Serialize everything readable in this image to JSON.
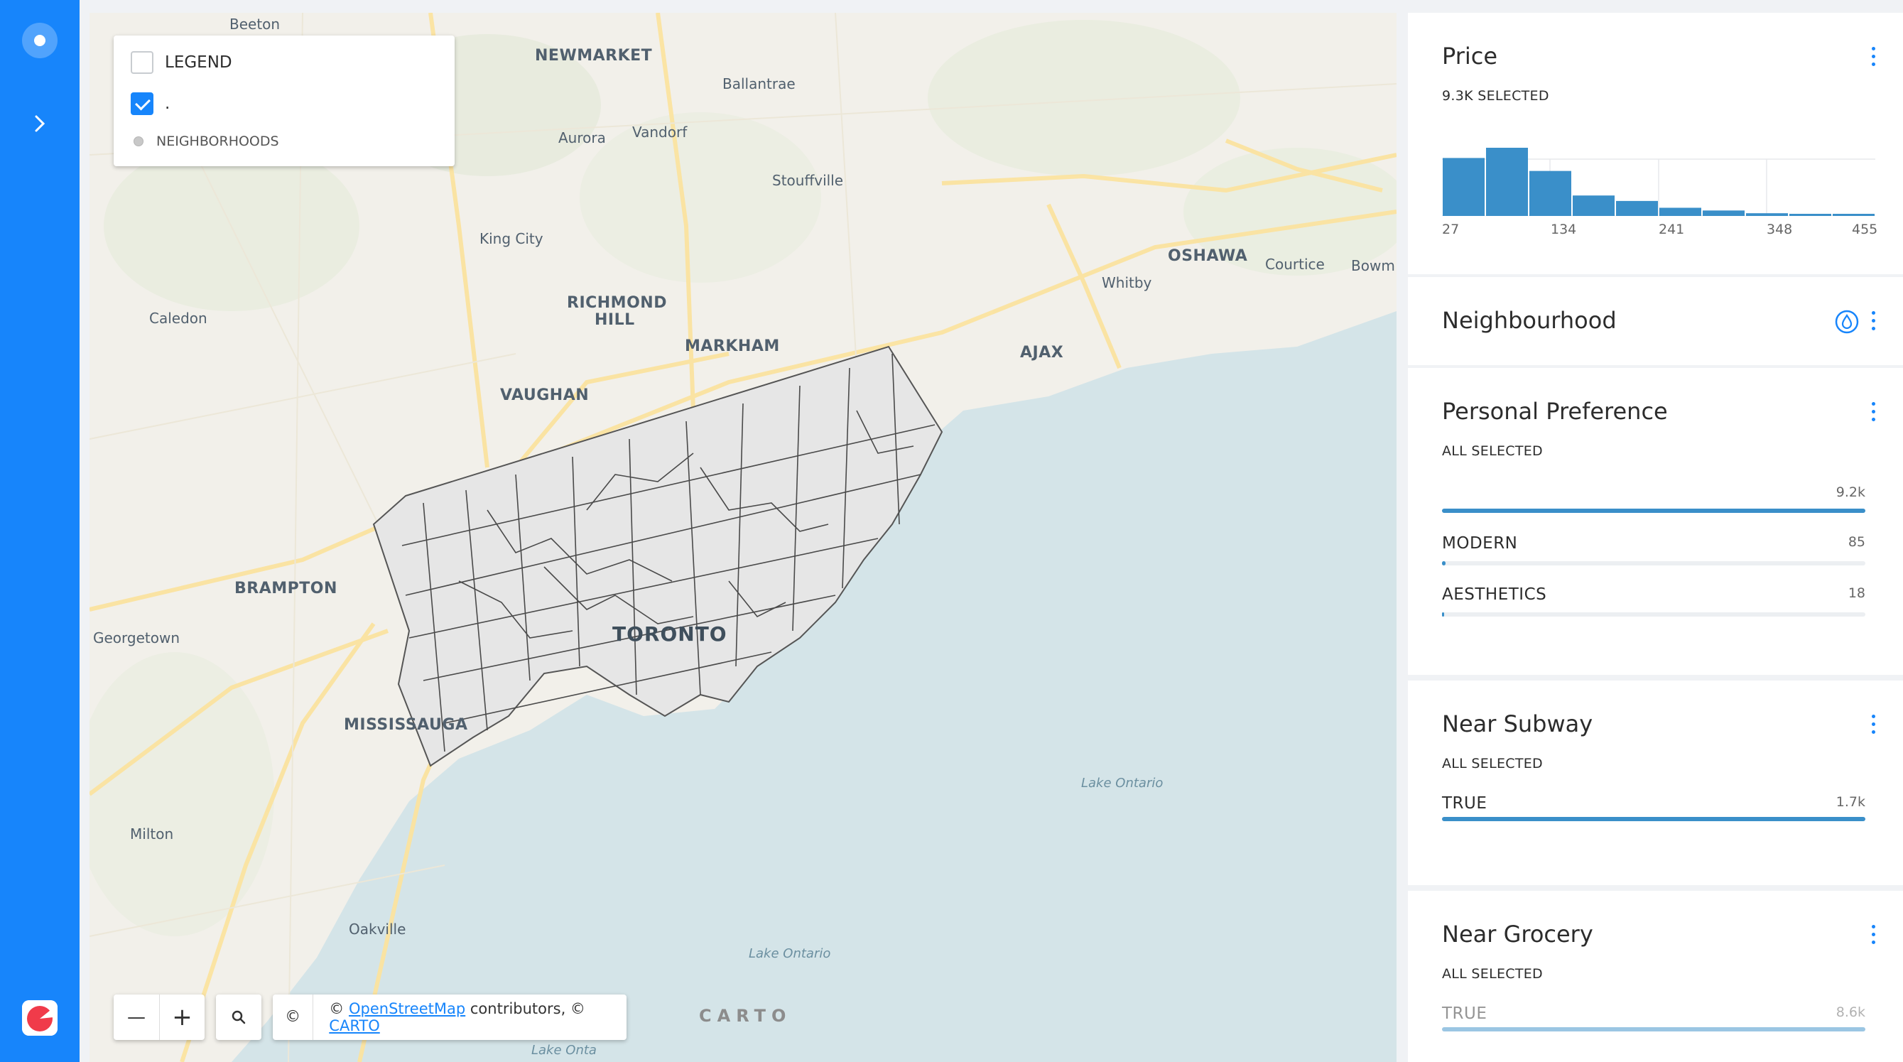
{
  "sidebar": {
    "top_icon": "circle-dot-icon",
    "expand_icon": "chevron-right-icon",
    "logo_icon": "carto-logo-icon",
    "accent": "#1785fb"
  },
  "map": {
    "legend": {
      "title": "LEGEND",
      "layer_label": ".",
      "item_label": "NEIGHBORHOODS"
    },
    "places": {
      "beeton": "Beeton",
      "newmarket": "NEWMARKET",
      "ballantrae": "Ballantrae",
      "aurora": "Aurora",
      "vandorf": "Vandorf",
      "stouffville": "Stouffville",
      "king_city": "King City",
      "oshawa": "OSHAWA",
      "courtice": "Courtice",
      "bowm": "Bowm",
      "whitby": "Whitby",
      "caledon": "Caledon",
      "richmond_hill_1": "RICHMOND",
      "richmond_hill_2": "HILL",
      "markham": "MARKHAM",
      "ajax": "AJAX",
      "vaughan": "VAUGHAN",
      "brampton": "BRAMPTON",
      "georgetown": "Georgetown",
      "toronto": "TORONTO",
      "mississauga": "MISSISSAUGA",
      "lake_ontario_1": "Lake Ontario",
      "milton": "Milton",
      "oakville": "Oakville",
      "lake_ontario_2": "Lake Ontario",
      "lake_onta": "Lake Onta"
    },
    "controls": {
      "zoom_out": "—",
      "zoom_in": "+",
      "search_icon": "search-icon"
    },
    "attribution": {
      "copyright_symbol": "©",
      "prefix": "© ",
      "osm_link": "OpenStreetMap",
      "middle": " contributors, © ",
      "carto_link": "CARTO"
    },
    "watermark": "CARTO",
    "colors": {
      "land": "#f2f0ea",
      "water": "#d4e4e8",
      "roads": "#fde6a0",
      "neighborhood_fill": "#e6e6e6",
      "neighborhood_stroke": "#444444"
    }
  },
  "widgets": {
    "price": {
      "title": "Price",
      "subtitle": "9.3K SELECTED",
      "axis": [
        "27",
        "134",
        "241",
        "348",
        "455"
      ],
      "bars": [
        0.85,
        1.0,
        0.66,
        0.3,
        0.22,
        0.12,
        0.08,
        0.04,
        0.03,
        0.03
      ]
    },
    "neighbourhood": {
      "title": "Neighbourhood",
      "style_icon": "droplet-icon"
    },
    "personal_preference": {
      "title": "Personal Preference",
      "subtitle": "ALL SELECTED",
      "total": "9.2k",
      "total_fraction": 1.0,
      "items": [
        {
          "name": "MODERN",
          "value": "85",
          "fraction": 0.009
        },
        {
          "name": "AESTHETICS",
          "value": "18",
          "fraction": 0.004
        }
      ]
    },
    "near_subway": {
      "title": "Near Subway",
      "subtitle": "ALL SELECTED",
      "items": [
        {
          "name": "TRUE",
          "value": "1.7k",
          "fraction": 1.0
        }
      ]
    },
    "near_grocery": {
      "title": "Near Grocery",
      "subtitle": "ALL SELECTED",
      "items": [
        {
          "name": "TRUE",
          "value": "8.6k",
          "fraction": 1.0
        }
      ]
    },
    "bar_color": "#3a8fc9",
    "menu_icon": "more-vertical-icon"
  }
}
